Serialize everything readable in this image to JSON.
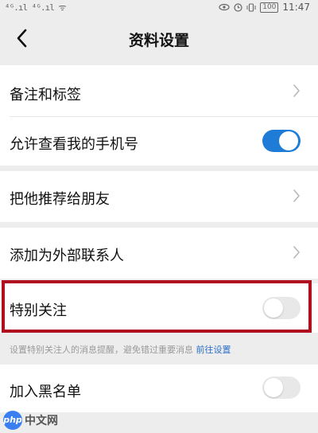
{
  "status_bar": {
    "signal_text": "⁴ᴳ.ıl ⁴ᴳ.ıl ᯤ",
    "battery": "100",
    "time": "11:47"
  },
  "nav": {
    "title": "资料设置"
  },
  "rows": [
    {
      "label": "备注和标签",
      "control": "chevron"
    },
    {
      "label": "允许查看我的手机号",
      "control": "toggle",
      "enabled": true
    },
    {
      "label": "把他推荐给朋友",
      "control": "chevron"
    },
    {
      "label": "添加为外部联系人",
      "control": "chevron"
    },
    {
      "label": "特别关注",
      "control": "toggle",
      "enabled": false
    },
    {
      "label": "加入黑名单",
      "control": "toggle",
      "enabled": false
    }
  ],
  "hint": {
    "text": "设置特别关注人的消息提醒，避免错过重要消息",
    "link": "前往设置"
  },
  "watermark": {
    "logo": "php",
    "text": "中文网"
  },
  "colors": {
    "accent": "#1f7cd6",
    "highlight_border": "#b00f1f",
    "link": "#2a6fc9",
    "background": "#ededed"
  }
}
